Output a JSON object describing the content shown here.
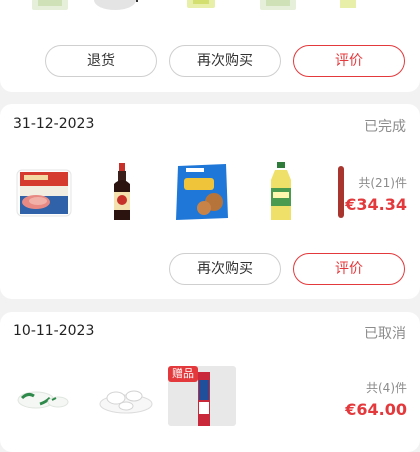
{
  "orders": [
    {
      "buttons": {
        "return": "退货",
        "rebuy": "再次购买",
        "review": "评价"
      },
      "thumbs": [
        "product-image",
        "product-image",
        "product-image",
        "product-image",
        "product-image"
      ]
    },
    {
      "date": "31-12-2023",
      "status": "已完成",
      "count": "共(21)件",
      "price": "€34.34",
      "thumbs": [
        "canned-meat-image",
        "sauce-bottle-image",
        "snack-bag-image",
        "oil-bottle-image",
        "sausage-image"
      ],
      "buttons": {
        "rebuy": "再次购买",
        "review": "评价"
      }
    },
    {
      "date": "10-11-2023",
      "status": "已取消",
      "count": "共(4)件",
      "price": "€64.00",
      "gift_label": "赠品",
      "thumbs": [
        "plates-image",
        "bowls-image",
        "gift-image"
      ]
    }
  ],
  "colors": {
    "accent": "#e4393c",
    "muted": "#8c8c8c",
    "page_bg": "#f2f2f2"
  }
}
